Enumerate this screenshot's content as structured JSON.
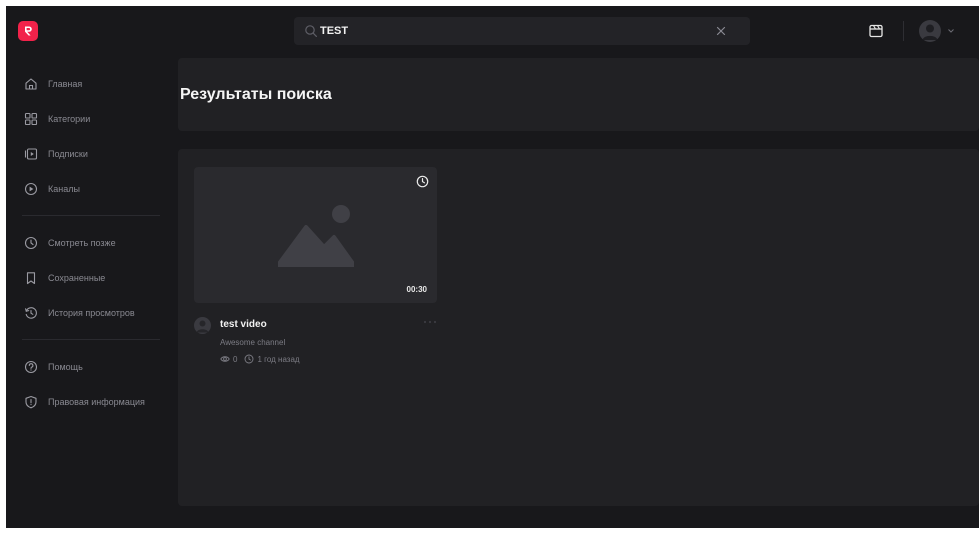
{
  "header": {
    "search": {
      "value": "TEST",
      "placeholder": ""
    }
  },
  "sidebar": {
    "items": [
      {
        "label": "Главная",
        "icon": "home-icon"
      },
      {
        "label": "Категории",
        "icon": "grid-icon"
      },
      {
        "label": "Подписки",
        "icon": "subscriptions-icon"
      },
      {
        "label": "Каналы",
        "icon": "play-circle-icon"
      },
      {
        "label": "Смотреть позже",
        "icon": "clock-icon"
      },
      {
        "label": "Сохраненные",
        "icon": "bookmark-icon"
      },
      {
        "label": "История просмотров",
        "icon": "history-icon"
      },
      {
        "label": "Помощь",
        "icon": "help-icon"
      },
      {
        "label": "Правовая информация",
        "icon": "shield-icon"
      }
    ]
  },
  "main": {
    "title": "Результаты поиска",
    "results": [
      {
        "title": "test video",
        "channel": "Awesome channel",
        "duration": "00:30",
        "views": "0",
        "age": "1 год назад"
      }
    ]
  },
  "colors": {
    "background": "#18181b",
    "card": "#212124",
    "accent": "#f2224a",
    "muted_text": "#8a8a92"
  }
}
